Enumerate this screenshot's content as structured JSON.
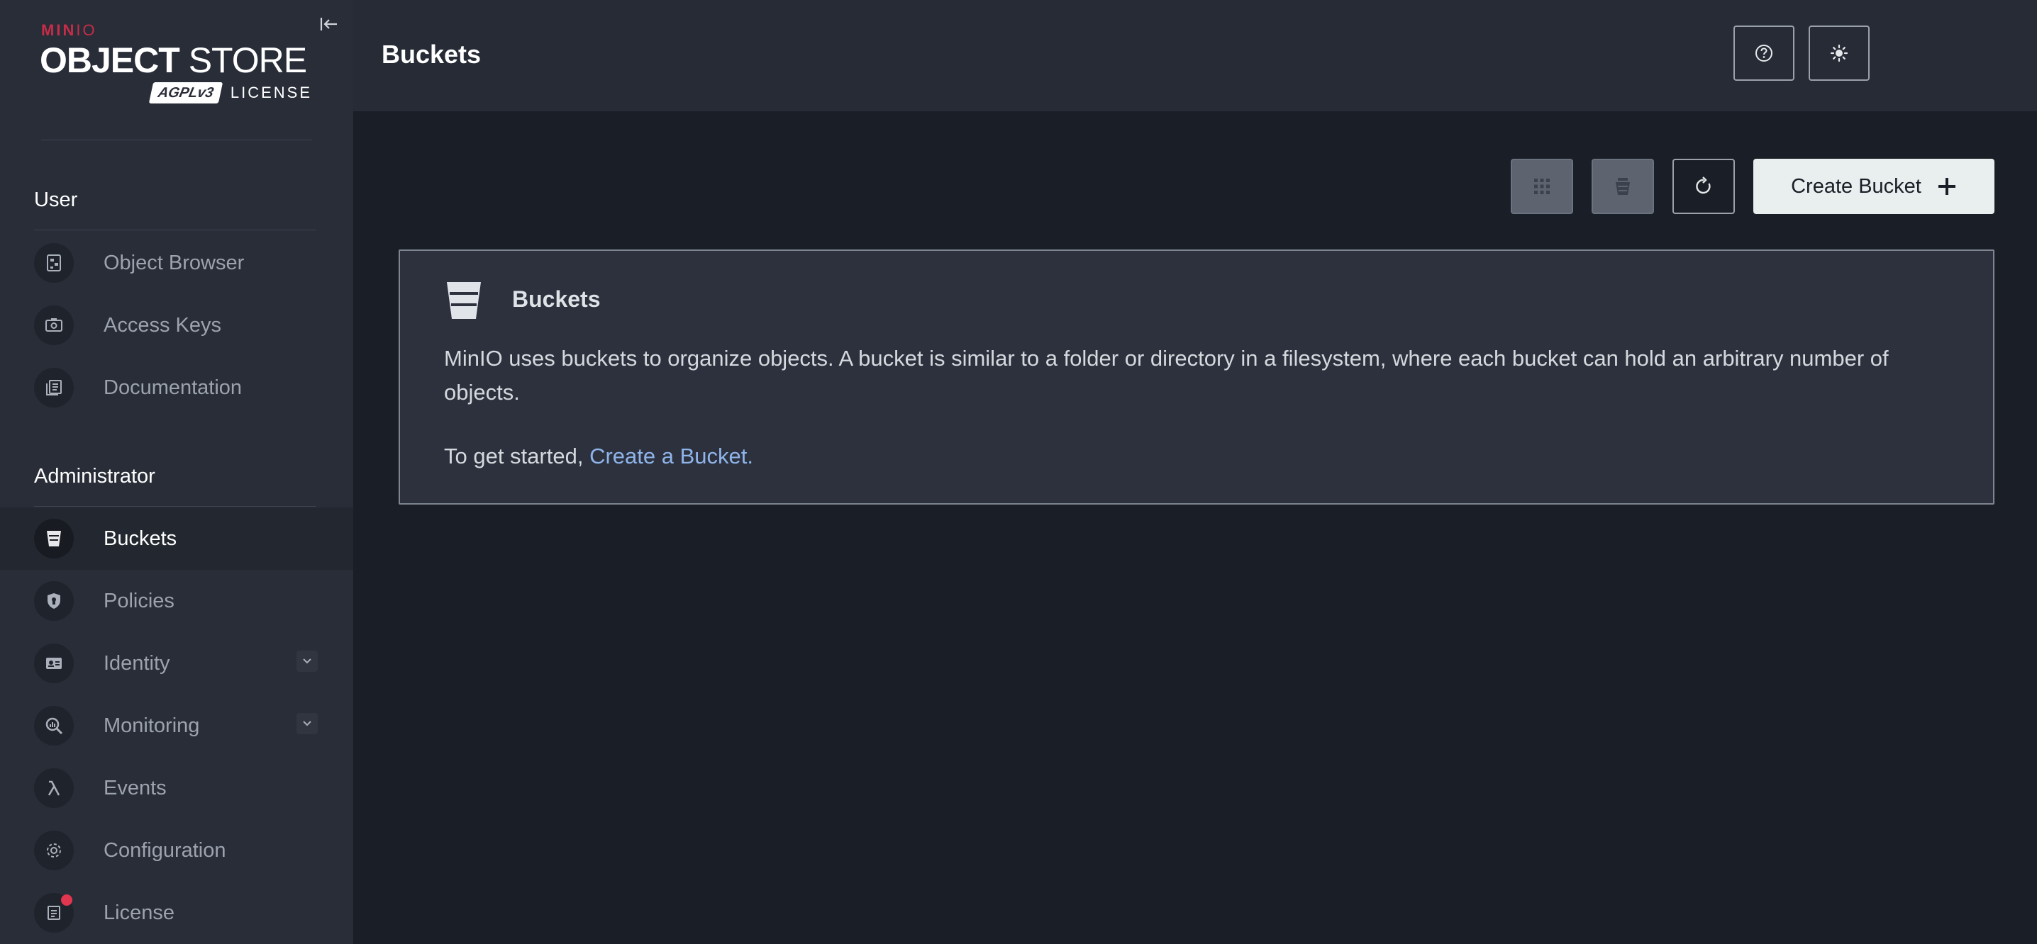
{
  "brand": {
    "minio_left": "MIN",
    "minio_right": "IO",
    "product_bold": "OBJECT",
    "product_rest": " STORE",
    "agpl_badge": "AGPLv3",
    "license_word": "LICENSE"
  },
  "sidebar": {
    "user_section": "User",
    "admin_section": "Administrator",
    "user_items": [
      {
        "label": "Object Browser",
        "icon": "object-browser-icon"
      },
      {
        "label": "Access Keys",
        "icon": "access-keys-icon"
      },
      {
        "label": "Documentation",
        "icon": "documentation-icon"
      }
    ],
    "admin_items": [
      {
        "label": "Buckets",
        "icon": "bucket-icon",
        "active": true
      },
      {
        "label": "Policies",
        "icon": "shield-icon"
      },
      {
        "label": "Identity",
        "icon": "id-card-icon",
        "expandable": true
      },
      {
        "label": "Monitoring",
        "icon": "magnifier-chart-icon",
        "expandable": true
      },
      {
        "label": "Events",
        "icon": "lambda-icon"
      },
      {
        "label": "Configuration",
        "icon": "gear-icon"
      },
      {
        "label": "License",
        "icon": "license-icon",
        "notification": true
      }
    ]
  },
  "header": {
    "title": "Buckets"
  },
  "toolbar": {
    "create_label": "Create Bucket"
  },
  "info_card": {
    "title": "Buckets",
    "body": "MinIO uses buckets to organize objects. A bucket is similar to a folder or directory in a filesystem, where each bucket can hold an arbitrary number of objects.",
    "cta_prefix": "To get started, ",
    "cta_link": "Create a Bucket."
  },
  "colors": {
    "sidebar_bg": "#282d38",
    "main_bg": "#1a1e26",
    "brand_red": "#c72c48",
    "link_blue": "#8fb4ea",
    "notification_red": "#e0364f"
  }
}
